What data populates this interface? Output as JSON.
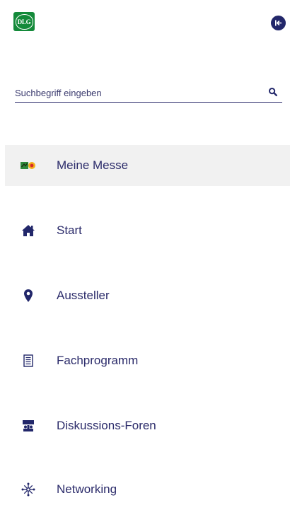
{
  "header": {
    "logo_text": "DLG",
    "collapse_icon": "collapse-left-icon"
  },
  "search": {
    "placeholder": "Suchbegriff eingeben",
    "value": "",
    "icon": "search-icon"
  },
  "nav": {
    "items": [
      {
        "label": "Meine Messe",
        "icon": "my-fair-icon",
        "active": true
      },
      {
        "label": "Start",
        "icon": "home-icon",
        "active": false
      },
      {
        "label": "Aussteller",
        "icon": "map-pin-icon",
        "active": false
      },
      {
        "label": "Fachprogramm",
        "icon": "list-document-icon",
        "active": false
      },
      {
        "label": "Diskussions-Foren",
        "icon": "forum-icon",
        "active": false
      },
      {
        "label": "Networking",
        "icon": "network-icon",
        "active": false
      }
    ]
  },
  "colors": {
    "brand_green": "#148a3a",
    "navy": "#22276a",
    "text": "#2b2b6a",
    "active_bg": "#f1f1f1"
  }
}
